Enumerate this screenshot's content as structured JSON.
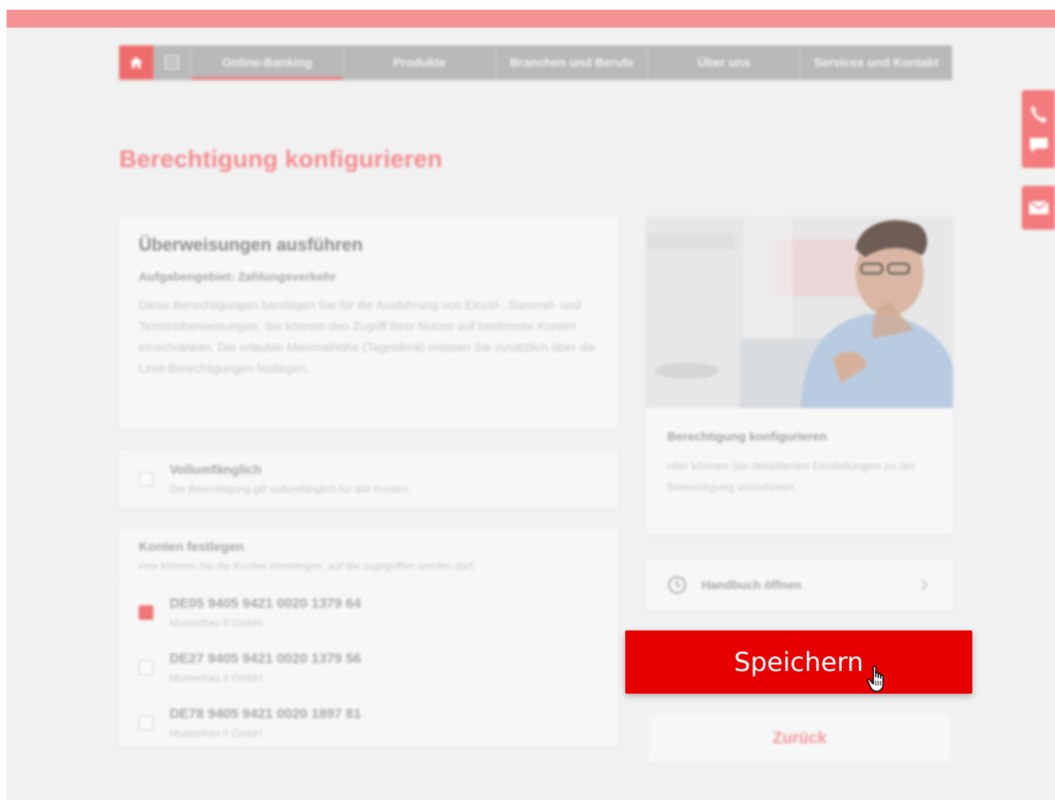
{
  "nav": {
    "items": [
      {
        "label": "Online-Banking",
        "active": true
      },
      {
        "label": "Produkte",
        "active": false
      },
      {
        "label": "Branchen und Berufe",
        "active": false
      },
      {
        "label": "Über uns",
        "active": false
      },
      {
        "label": "Services und Kontakt",
        "active": false
      }
    ]
  },
  "page": {
    "title": "Berechtigung konfigurieren"
  },
  "permission": {
    "title": "Überweisungen ausführen",
    "area": "Aufgabengebiet: Zahlungsverkehr",
    "description": "Diese Berechtigungen benötigen Sie für die Ausführung von Einzel-, Sammel- und Terminüberweisungen. Sie können den Zugriff Ihrer Nutzer auf bestimmte Konten einschränken. Die erlaubte Maximalhöhe (Tageslimit) müssen Sie zusätzlich über die Limit-Berechtigungen festlegen."
  },
  "full_access": {
    "label": "Vollumfänglich",
    "hint": "Die Berechtigung gilt vollumfänglich für alle Konten.",
    "checked": false
  },
  "accounts": {
    "title": "Konten festlegen",
    "hint": "Hier können Sie die Konten hinterlegen, auf die zugegriffen werden darf.",
    "items": [
      {
        "iban": "DE05 9405 9421 0020 1379 64",
        "holder": "Musterfrau II GmbH",
        "checked": true
      },
      {
        "iban": "DE27 9405 9421 0020 1379 56",
        "holder": "Musterfrau II GmbH",
        "checked": false
      },
      {
        "iban": "DE78 9405 9421 0020 1897 81",
        "holder": "Musterfrau II GmbH",
        "checked": false
      }
    ]
  },
  "info_card": {
    "title": "Berechtigung konfigurieren",
    "text": "Hier können Sie detaillierten Einstellungen zu der Berechtigung vornehmen."
  },
  "manual": {
    "label": "Handbuch öffnen"
  },
  "actions": {
    "save_label": "Speichern",
    "back_label": "Zurück"
  },
  "colors": {
    "primary": "#e60000",
    "topbar": "#f59295",
    "title": "#f58b8d"
  }
}
